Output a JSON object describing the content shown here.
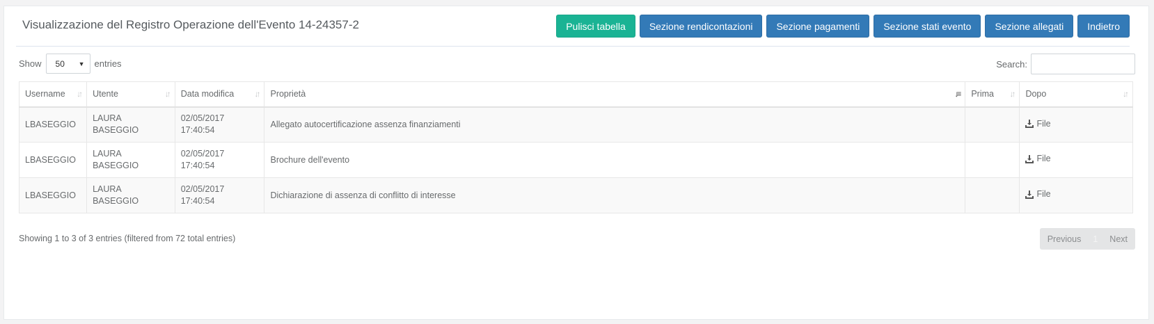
{
  "header": {
    "title": "Visualizzazione del Registro Operazione dell'Evento 14-24357-2",
    "buttons": {
      "clear": "Pulisci tabella",
      "reports": "Sezione rendicontazioni",
      "payments": "Sezione pagamenti",
      "states": "Sezione stati evento",
      "attachments": "Sezione allegati",
      "back": "Indietro"
    }
  },
  "controls": {
    "show_label": "Show",
    "page_size": "50",
    "entries_label": "entries",
    "search_label": "Search:",
    "search_value": ""
  },
  "table": {
    "columns": [
      "Username",
      "Utente",
      "Data modifica",
      "Proprietà",
      "Prima",
      "Dopo"
    ],
    "rows": [
      {
        "username": "LBASEGGIO",
        "utente_1": "LAURA",
        "utente_2": "BASEGGIO",
        "date_1": "02/05/2017",
        "date_2": "17:40:54",
        "proprieta": "Allegato autocertificazione assenza finanziamenti",
        "prima": "",
        "dopo": "File"
      },
      {
        "username": "LBASEGGIO",
        "utente_1": "LAURA",
        "utente_2": "BASEGGIO",
        "date_1": "02/05/2017",
        "date_2": "17:40:54",
        "proprieta": "Brochure dell'evento",
        "prima": "",
        "dopo": "File"
      },
      {
        "username": "LBASEGGIO",
        "utente_1": "LAURA",
        "utente_2": "BASEGGIO",
        "date_1": "02/05/2017",
        "date_2": "17:40:54",
        "proprieta": "Dichiarazione di assenza di conflitto di interesse",
        "prima": "",
        "dopo": "File"
      }
    ]
  },
  "footer": {
    "info": "Showing 1 to 3 of 3 entries (filtered from 72 total entries)",
    "prev": "Previous",
    "page": "1",
    "next": "Next"
  },
  "colors": {
    "primary": "#337ab7",
    "success": "#1ab394",
    "text": "#676a6c"
  },
  "icons": {
    "sort": "sort-icon",
    "sort_active": "sort-desc-icon",
    "download": "download-icon",
    "select_caret": "caret-down-icon"
  }
}
